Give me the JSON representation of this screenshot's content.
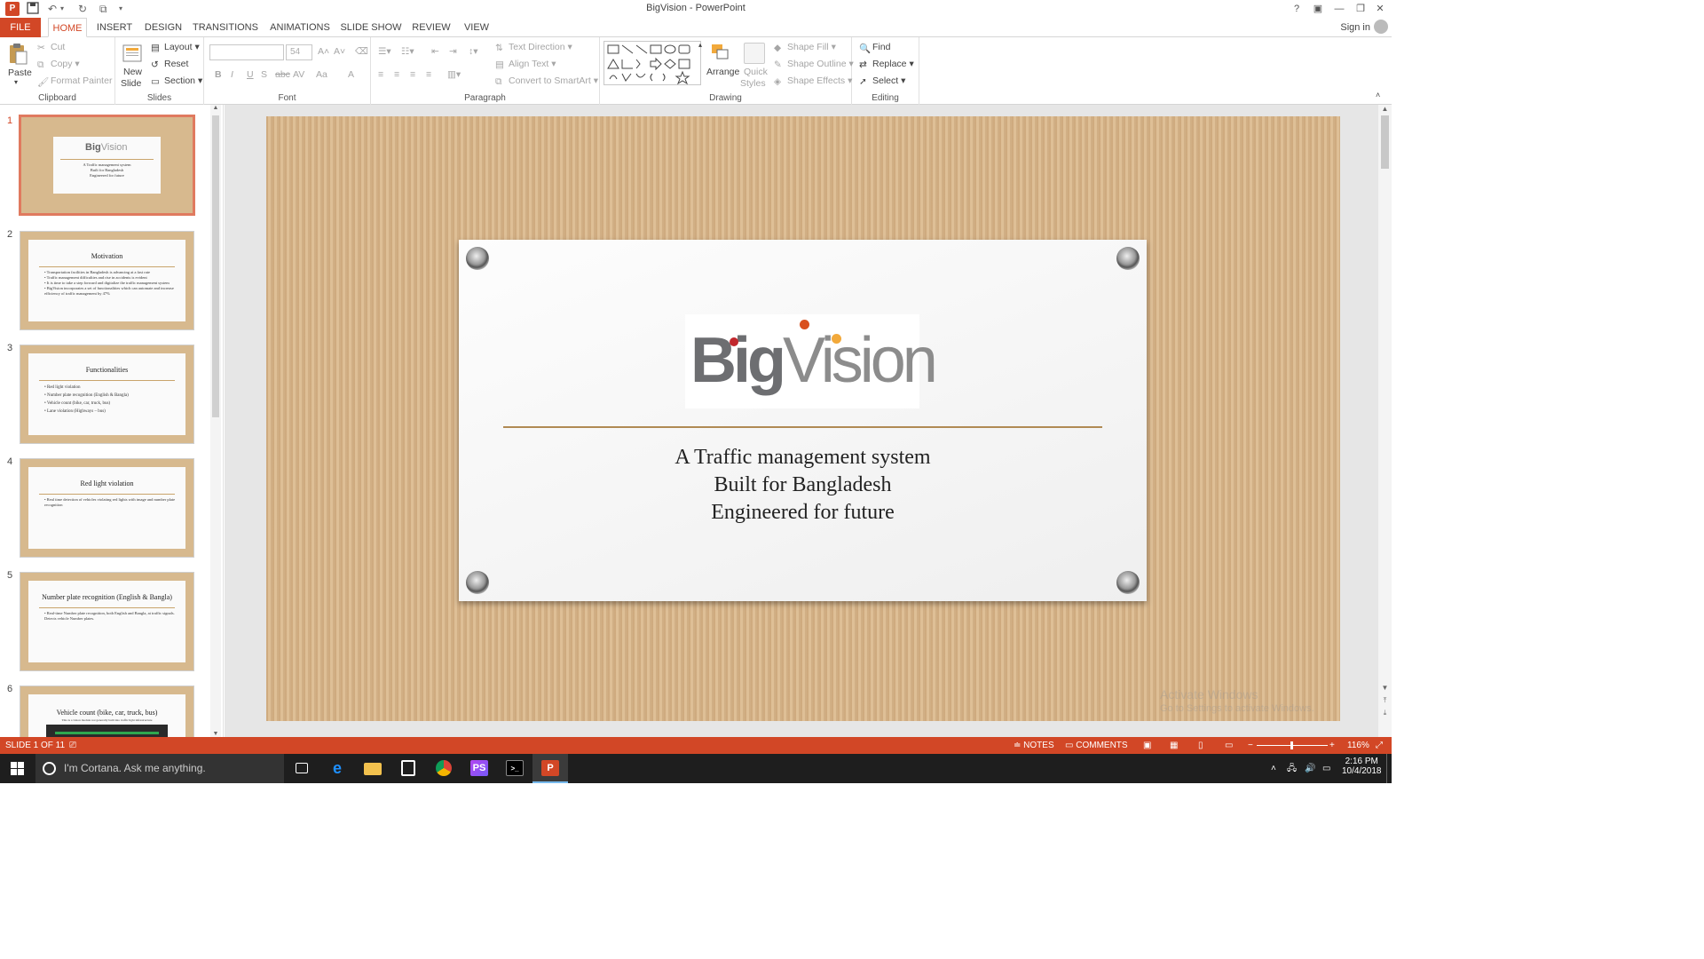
{
  "titlebar": {
    "title": "BigVision - PowerPoint",
    "app_icon": "P",
    "help": "?",
    "minimize": "—",
    "restore": "❐",
    "close": "✕"
  },
  "tabs": {
    "file": "FILE",
    "home": "HOME",
    "insert": "INSERT",
    "design": "DESIGN",
    "transitions": "TRANSITIONS",
    "animations": "ANIMATIONS",
    "slideshow": "SLIDE SHOW",
    "review": "REVIEW",
    "view": "VIEW",
    "signin": "Sign in"
  },
  "ribbon": {
    "clipboard": {
      "label": "Clipboard",
      "paste": "Paste",
      "cut": "Cut",
      "copy": "Copy",
      "format_painter": "Format Painter"
    },
    "slides": {
      "label": "Slides",
      "new_slide": "New",
      "new_slide2": "Slide",
      "layout": "Layout",
      "reset": "Reset",
      "section": "Section"
    },
    "font": {
      "label": "Font",
      "font_name": "",
      "font_size": "54",
      "bold": "B",
      "italic": "I",
      "underline": "U",
      "shadow": "S",
      "strike": "abc",
      "spacing": "AV",
      "case": "Aa",
      "color": "A"
    },
    "paragraph": {
      "label": "Paragraph",
      "text_direction": "Text Direction",
      "align_text": "Align Text",
      "smartart": "Convert to SmartArt"
    },
    "drawing": {
      "label": "Drawing",
      "arrange": "Arrange",
      "quick_styles": "Quick",
      "quick_styles2": "Styles",
      "shape_fill": "Shape Fill",
      "shape_outline": "Shape Outline",
      "shape_effects": "Shape Effects"
    },
    "editing": {
      "label": "Editing",
      "find": "Find",
      "replace": "Replace",
      "select": "Select"
    }
  },
  "thumbnails": [
    {
      "num": "1",
      "title": "",
      "text": "A Traffic management system\nBuilt for Bangladesh\nEngineered for future",
      "selected": true
    },
    {
      "num": "2",
      "title": "Motivation",
      "text": "• Transportation facilities in Bangladesh is advancing at a fast rate\n• Traffic management difficulties and rise in accidents is evident\n• It is time to take a step forward and digitalize the traffic management system\n• BigVision incorporates a set of functionalities which can automate and increase efficiency of traffic management by 47%",
      "selected": false
    },
    {
      "num": "3",
      "title": "Functionalities",
      "text": "• Red light violation\n• Number plate recognition (English & Bangla)\n• Vehicle count (bike, car, truck, bus)\n• Lane violation (Highways – bus)",
      "selected": false
    },
    {
      "num": "4",
      "title": "Red light violation",
      "text": "• Real time detection of vehicles violating red lights with image and number plate recognition",
      "selected": false
    },
    {
      "num": "5",
      "title": "Number plate recognition (English & Bangla)",
      "text": "• Real-time Number plate recognition, both English and Bangla, at traffic signals. Detects vehicle Number plates.",
      "selected": false
    },
    {
      "num": "6",
      "title": "Vehicle count (bike, car, truck, bus)",
      "text": "This is a vision module not generally built into traffic light infrastructure",
      "selected": false
    }
  ],
  "slide": {
    "logo_big": "Big",
    "logo_vision": "Visi",
    "logo_on": "on",
    "subtitle_1": "A Traffic management system",
    "subtitle_2": "Built for Bangladesh",
    "subtitle_3": "Engineered for future",
    "colors": {
      "logo_red": "#c1272d",
      "logo_orange": "#d9501e",
      "logo_yellow": "#f2a93b",
      "gray": "#6d6e71",
      "accent": "#d24726"
    }
  },
  "watermark": {
    "line1": "Activate Windows",
    "line2": "Go to Settings to activate Windows."
  },
  "statusbar": {
    "slide_info": "SLIDE 1 OF 11",
    "notes": "NOTES",
    "comments": "COMMENTS",
    "zoom": "116%"
  },
  "taskbar": {
    "cortana": "I'm Cortana. Ask me anything.",
    "time": "2:16 PM",
    "date": "10/4/2018"
  }
}
